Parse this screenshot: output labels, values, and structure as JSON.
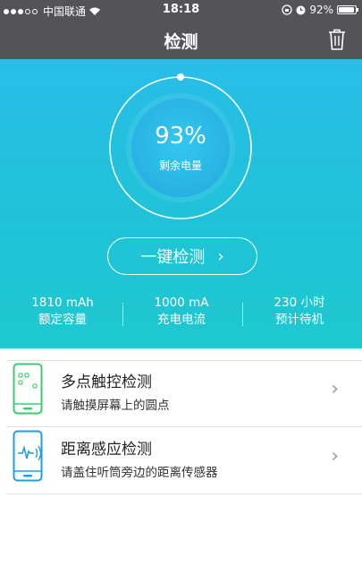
{
  "status_bar": {
    "carrier": "中国联通",
    "time": "18:18",
    "battery_percent": "92%",
    "battery_level": 0.92,
    "wifi_icon": "wifi-icon",
    "alarm_icon": "alarm-icon",
    "lock_icon": "rotation-lock-icon"
  },
  "nav": {
    "title": "检测",
    "trash_icon": "trash-icon"
  },
  "gauge": {
    "value": "93%",
    "label": "剩余电量",
    "level": 0.93
  },
  "one_key_check": {
    "label": "一键检测",
    "chevron": "›"
  },
  "stats": [
    {
      "value": "1810 mAh",
      "label": "额定容量"
    },
    {
      "value": "1000 mA",
      "label": "充电电流"
    },
    {
      "value": "230 小时",
      "label": "预计待机"
    }
  ],
  "tests": [
    {
      "title": "多点触控检测",
      "subtitle": "请触摸屏幕上的圆点",
      "icon": "multitouch-phone-icon",
      "color": "#3ecb6b"
    },
    {
      "title": "距离感应检测",
      "subtitle": "请盖住听筒旁边的距离传感器",
      "icon": "proximity-sensor-phone-icon",
      "color": "#1f9fe3"
    }
  ],
  "colors": {
    "nav_bg": "#545458",
    "hero_top": "#29bde8",
    "hero_bottom": "#1fc8cf",
    "chevron": "#9a9a9a"
  }
}
